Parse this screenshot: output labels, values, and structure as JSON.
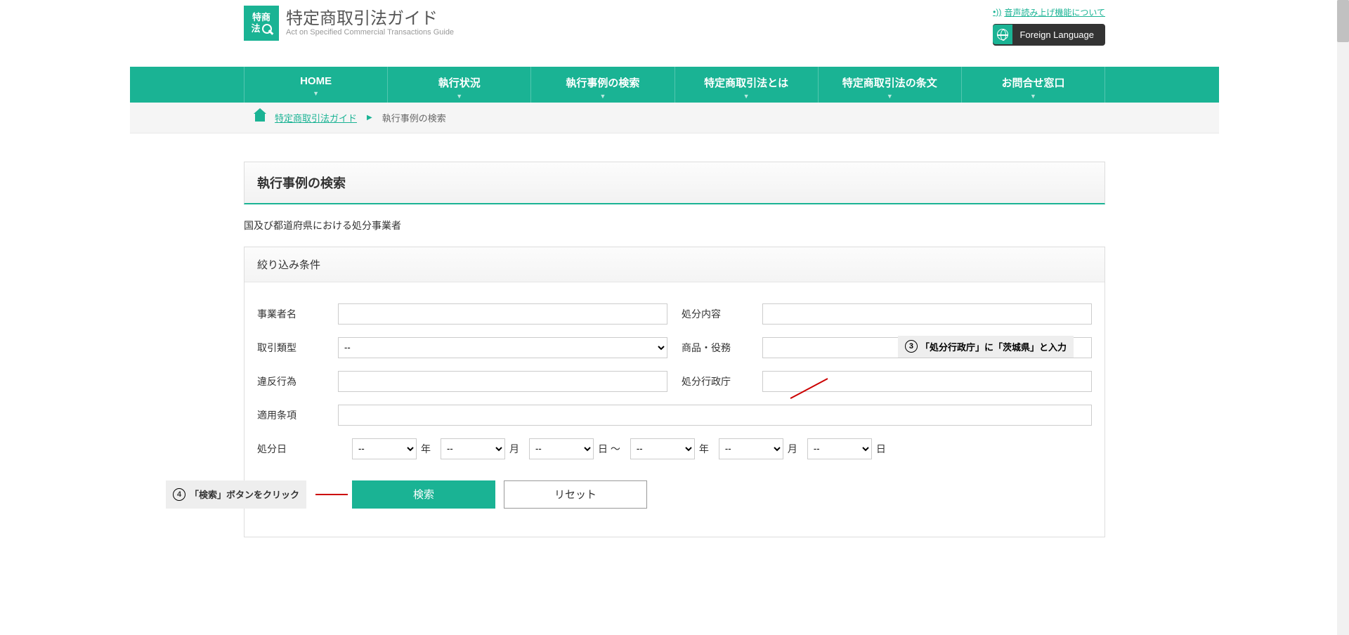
{
  "header": {
    "logo_chars_top": "特商",
    "logo_chars_bot": "法",
    "title": "特定商取引法ガイド",
    "subtitle": "Act on Specified Commercial Transactions Guide",
    "voice_link": "音声読み上げ機能について",
    "lang_button": "Foreign Language"
  },
  "nav": [
    "HOME",
    "執行状況",
    "執行事例の検索",
    "特定商取引法とは",
    "特定商取引法の条文",
    "お問合せ窓口"
  ],
  "breadcrumb": {
    "home": "特定商取引法ガイド",
    "current": "執行事例の検索"
  },
  "page": {
    "title": "執行事例の検索",
    "subheading": "国及び都道府県における処分事業者"
  },
  "panel": {
    "title": "絞り込み条件",
    "labels": {
      "operator": "事業者名",
      "content": "処分内容",
      "tx_type": "取引類型",
      "goods": "商品・役務",
      "violation": "違反行為",
      "authority": "処分行政庁",
      "clause": "適用条項",
      "date": "処分日"
    },
    "tx_type_default": "--",
    "date_units": {
      "year": "年",
      "month": "月",
      "day": "日",
      "to": "～"
    },
    "date_default": "--",
    "buttons": {
      "search": "検索",
      "reset": "リセット"
    }
  },
  "annotations": {
    "a3_num": "3",
    "a3_text": "「処分行政庁」に「茨城県」と入力",
    "a4_num": "4",
    "a4_text": "「検索」ボタンをクリック"
  }
}
